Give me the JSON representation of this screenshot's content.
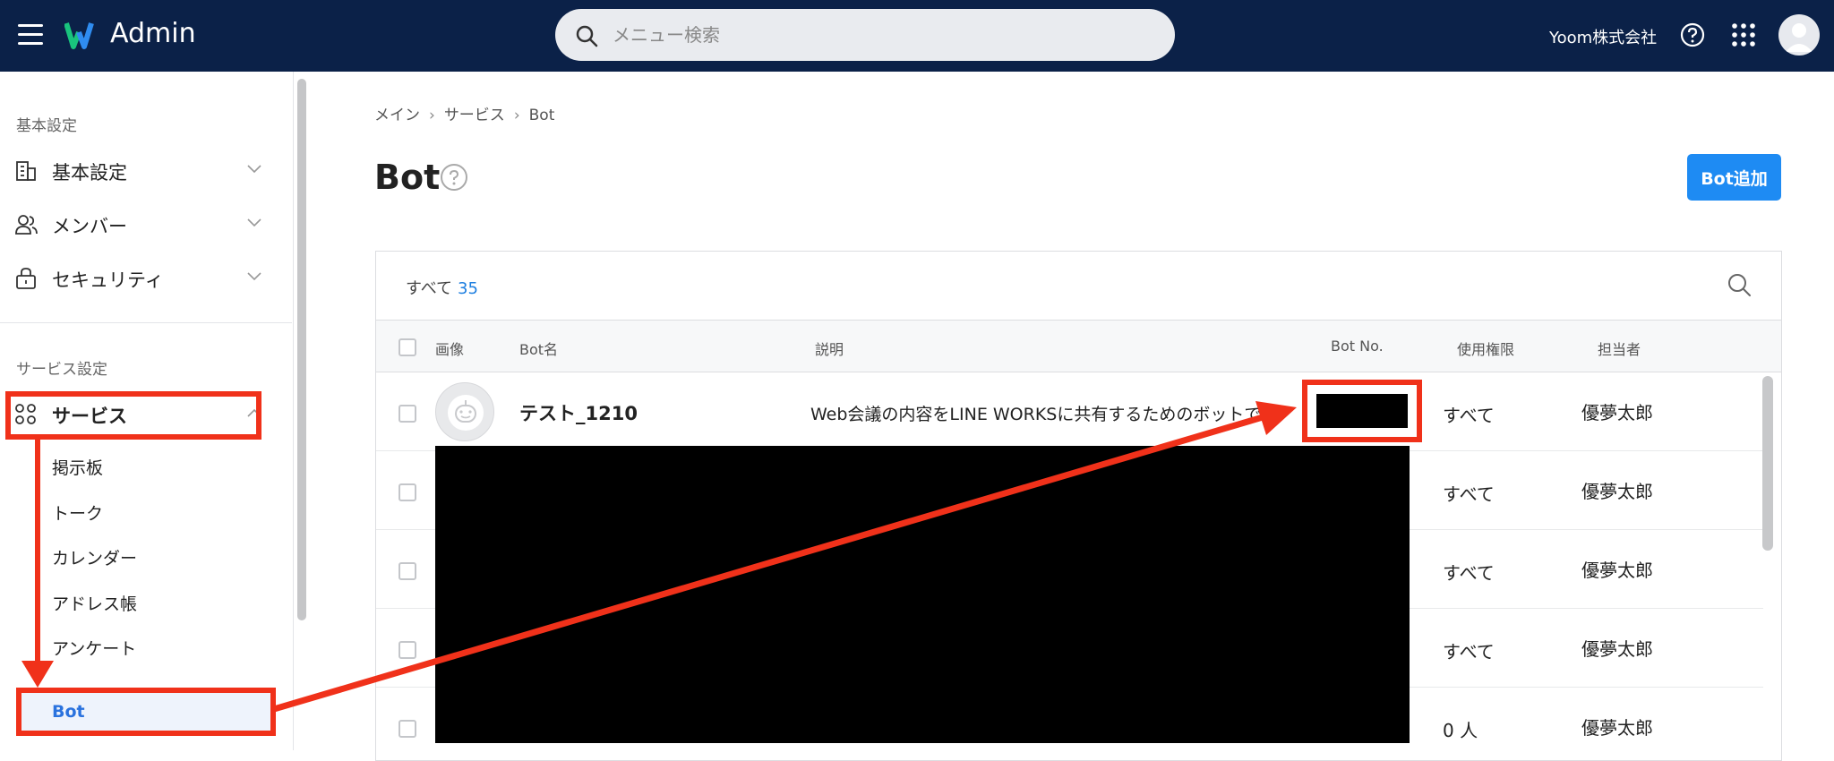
{
  "header": {
    "app_title": "Admin",
    "search_placeholder": "メニュー検索",
    "company": "Yoom株式会社"
  },
  "sidebar": {
    "section1_title": "基本設定",
    "items": [
      {
        "label": "基本設定"
      },
      {
        "label": "メンバー"
      },
      {
        "label": "セキュリティ"
      }
    ],
    "section2_title": "サービス設定",
    "service_label": "サービス",
    "sub_items": [
      "掲示板",
      "トーク",
      "カレンダー",
      "アドレス帳",
      "アンケート"
    ],
    "bot_label": "Bot"
  },
  "breadcrumb": {
    "items": [
      "メイン",
      "サービス",
      "Bot"
    ]
  },
  "page": {
    "title": "Bot",
    "add_button": "Bot追加"
  },
  "filter": {
    "label": "すべて",
    "count": "35"
  },
  "table": {
    "headers": [
      "画像",
      "Bot名",
      "説明",
      "Bot No.",
      "使用権限",
      "担当者"
    ],
    "rows": [
      {
        "name": "テスト_1210",
        "description": "Web会議の内容をLINE WORKSに共有するためのボットです",
        "permission": "すべて",
        "owner": "優夢太郎"
      },
      {
        "name": "",
        "description": "",
        "permission": "すべて",
        "owner": "優夢太郎"
      },
      {
        "name": "",
        "description": "",
        "permission": "すべて",
        "owner": "優夢太郎"
      },
      {
        "name": "",
        "description": "",
        "permission": "すべて",
        "owner": "優夢太郎"
      },
      {
        "name": "",
        "description": "",
        "permission": "0 人",
        "owner": "優夢太郎"
      }
    ]
  },
  "colors": {
    "header_bg": "#0b2148",
    "accent": "#1e8bf3",
    "highlight": "#f0311a"
  }
}
